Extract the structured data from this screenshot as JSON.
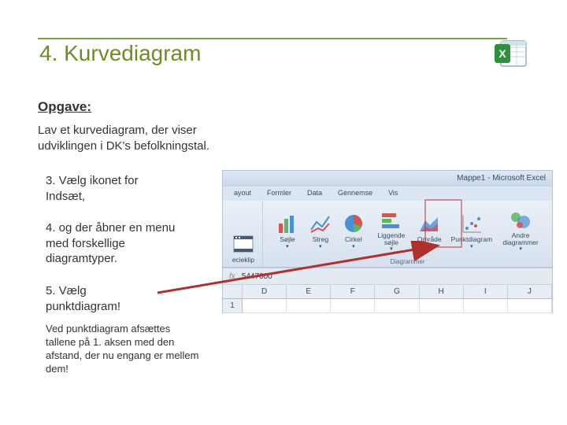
{
  "title": "4. Kurvediagram",
  "opgave_label": "Opgave:",
  "opgave_text": "Lav et kurvediagram, der viser udviklingen i DK's befolkningstal.",
  "step3": "3. Vælg ikonet for Indsæt,",
  "step4": "4. og der åbner en menu med forskellige diagramtyper.",
  "step5": "5. Vælg punktdiagram!",
  "footnote": "Ved punktdiagram afsættes tallene på 1. aksen med den afstand, der nu engang er mellem dem!",
  "excel": {
    "window_title": "Mappe1 - Microsoft Excel",
    "tabs": [
      "ayout",
      "Formler",
      "Data",
      "Gennemse",
      "Vis"
    ],
    "clip_group_hint": "ecieklip",
    "charts": [
      {
        "label": "Søjle"
      },
      {
        "label": "Streg"
      },
      {
        "label": "Cirkel"
      },
      {
        "label": "Liggende søjle"
      },
      {
        "label": "Område"
      },
      {
        "label": "Punktdiagram"
      },
      {
        "label": "Andre diagrammer"
      }
    ],
    "charts_group_label": "Diagrammer",
    "fx_label": "fx",
    "formula_value": "5447000",
    "columns": [
      "D",
      "E",
      "F",
      "G",
      "H",
      "I",
      "J"
    ],
    "row_num": "1"
  }
}
